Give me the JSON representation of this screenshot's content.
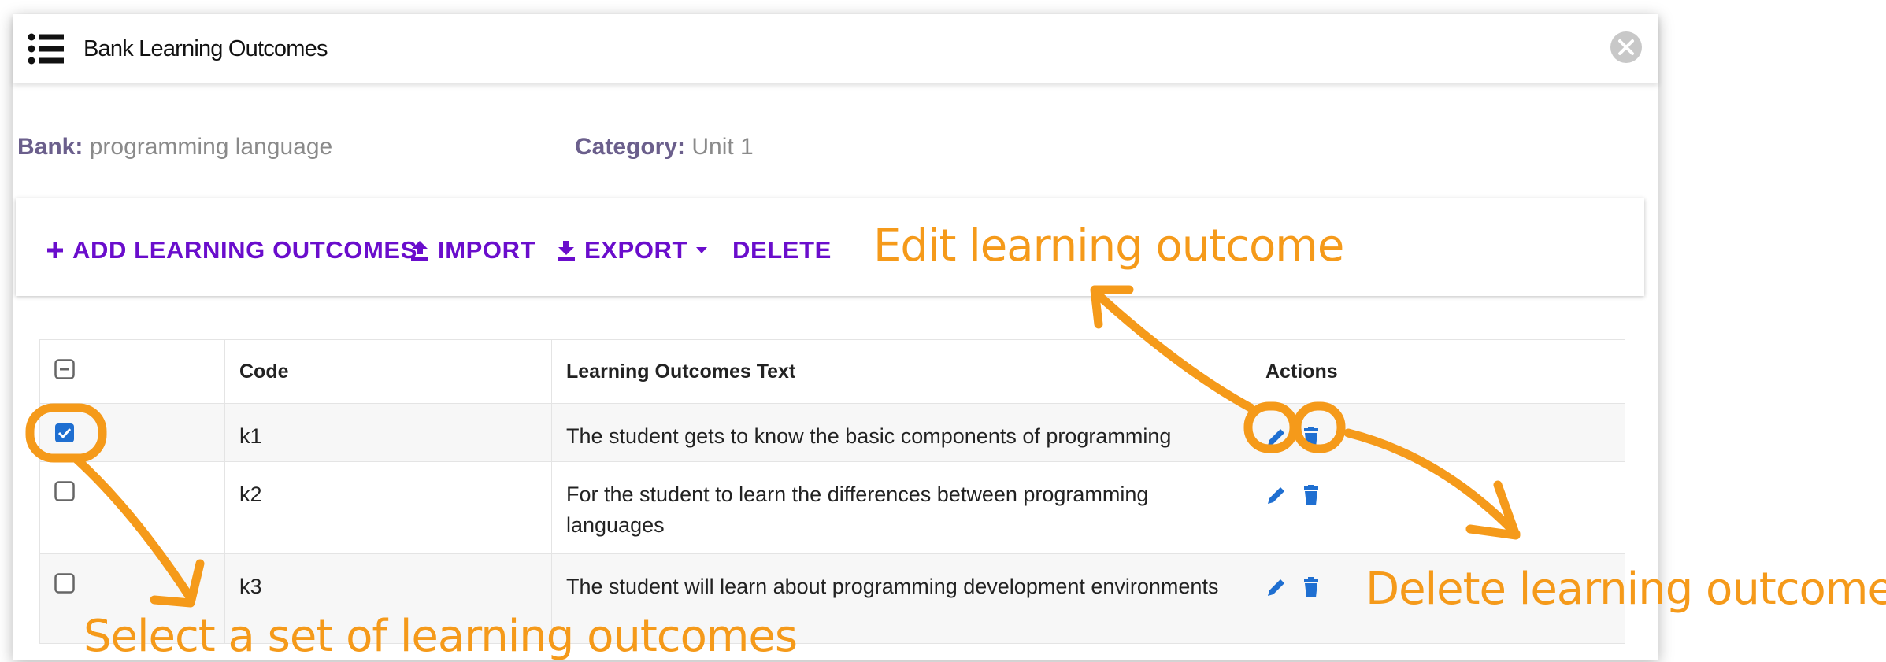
{
  "window": {
    "title": "Bank Learning Outcomes"
  },
  "meta": {
    "bank_label": "Bank:",
    "bank_value": "programming language",
    "category_label": "Category:",
    "category_value": "Unit 1"
  },
  "toolbar": {
    "add_label": "ADD LEARNING OUTCOMES",
    "import_label": "IMPORT",
    "export_label": "EXPORT",
    "delete_label": "DELETE"
  },
  "table": {
    "headers": {
      "code": "Code",
      "text": "Learning Outcomes Text",
      "actions": "Actions"
    },
    "rows": [
      {
        "code": "k1",
        "text": "The student gets to know the basic components of programming",
        "checked": true
      },
      {
        "code": "k2",
        "text": "For the student to learn the differences between programming languages",
        "checked": false
      },
      {
        "code": "k3",
        "text": "The student will learn about programming development environments",
        "checked": false
      }
    ]
  },
  "annotations": {
    "edit": "Edit learning outcome",
    "delete": "Delete learning outcomes",
    "select": "Select a set of learning outcomes"
  },
  "colors": {
    "accent": "#6a0dcc",
    "annotation": "#f59a1a",
    "icon_blue": "#1f6fd1"
  }
}
